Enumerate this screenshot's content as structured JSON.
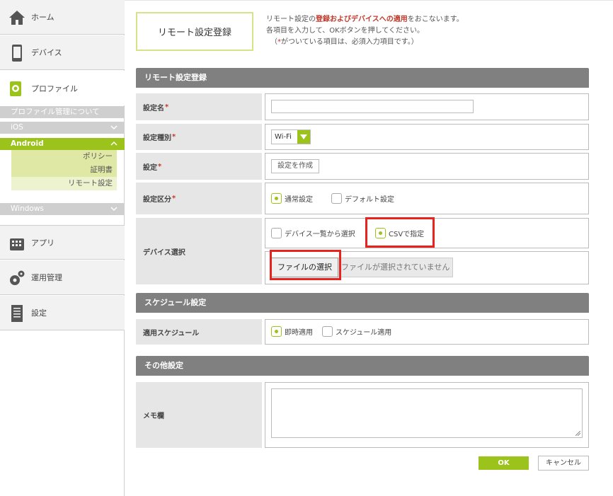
{
  "sidebar": {
    "home": "ホーム",
    "device": "デバイス",
    "profile": "プロファイル",
    "about": "プロファイル管理について",
    "ios": "iOS",
    "android": "Android",
    "android_items": [
      "ポリシー",
      "証明書",
      "リモート設定"
    ],
    "windows": "Windows",
    "app": "アプリ",
    "operation": "運用管理",
    "settings": "設定"
  },
  "header": {
    "title": "リモート設定登録",
    "desc_1a": "リモート設定の",
    "desc_1b": "登録およびデバイスへの適用",
    "desc_1c": "をおこないます。",
    "desc_2": "各項目を入力して、OKボタンを押してください。",
    "desc_3a": "（",
    "desc_3b": "*",
    "desc_3c": "がついている項目は、必須入力項目です。）"
  },
  "section1": {
    "title": "リモート設定登録",
    "name_label": "設定名",
    "type_label": "設定種別",
    "type_value": "Wi-Fi",
    "config_label": "設定",
    "create_button": "設定を作成",
    "category_label": "設定区分",
    "category_normal": "通常設定",
    "category_default": "デフォルト設定",
    "device_label": "デバイス選択",
    "device_list": "デバイス一覧から選択",
    "device_csv": "CSVで指定",
    "file_button": "ファイルの選択",
    "file_status": "ファイルが選択されていません",
    "required_mark": "*"
  },
  "section2": {
    "title": "スケジュール設定",
    "schedule_label": "適用スケジュール",
    "immediate": "即時適用",
    "scheduled": "スケジュール適用"
  },
  "section3": {
    "title": "その他設定",
    "memo_label": "メモ欄"
  },
  "footer": {
    "ok": "OK",
    "cancel": "キャンセル"
  },
  "colors": {
    "accent": "#9bc31c",
    "highlight": "#e8231d",
    "section_header": "#808080"
  }
}
